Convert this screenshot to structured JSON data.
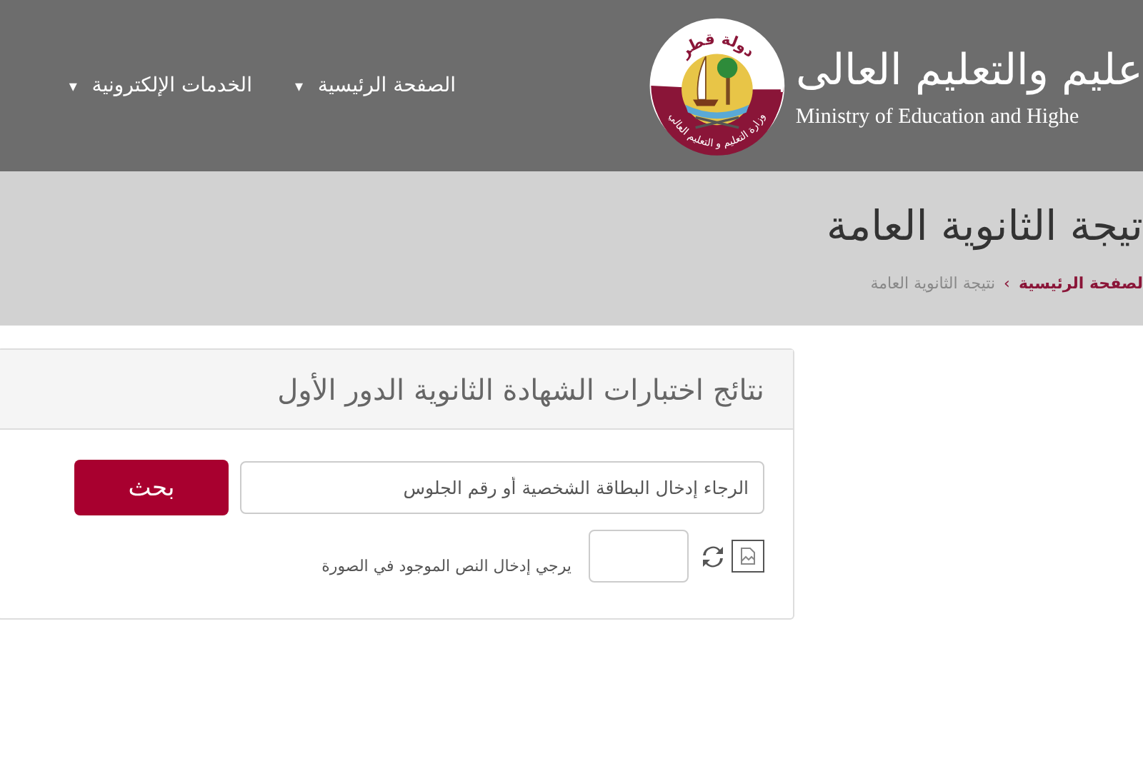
{
  "header": {
    "wordmark": {
      "arabic": "عليم والتعليم العالى",
      "english": "Ministry of Education and Highe"
    },
    "logo": {
      "top_text": "دولة قطر",
      "band_text": "وزارة التعليم و التعليم العالي"
    },
    "nav": [
      {
        "label": "الصفحة الرئيسية",
        "caret": "▾"
      },
      {
        "label": "الخدمات الإلكترونية",
        "caret": "▾"
      }
    ]
  },
  "page_title": "تيجة الثانوية العامة",
  "breadcrumb": [
    {
      "label": "لصفحة الرئيسية",
      "kind": "link"
    },
    {
      "label": "نتيجة الثانوية العامة",
      "kind": "current"
    }
  ],
  "breadcrumb_separator": "›",
  "panel": {
    "title": "نتائج اختبارات الشهادة الثانوية الدور الأول",
    "search": {
      "placeholder": "الرجاء إدخال البطاقة الشخصية أو رقم الجلوس"
    },
    "search_button": "بحث",
    "captcha": {
      "label": "يرجي إدخال النص الموجود في الصورة"
    }
  }
}
